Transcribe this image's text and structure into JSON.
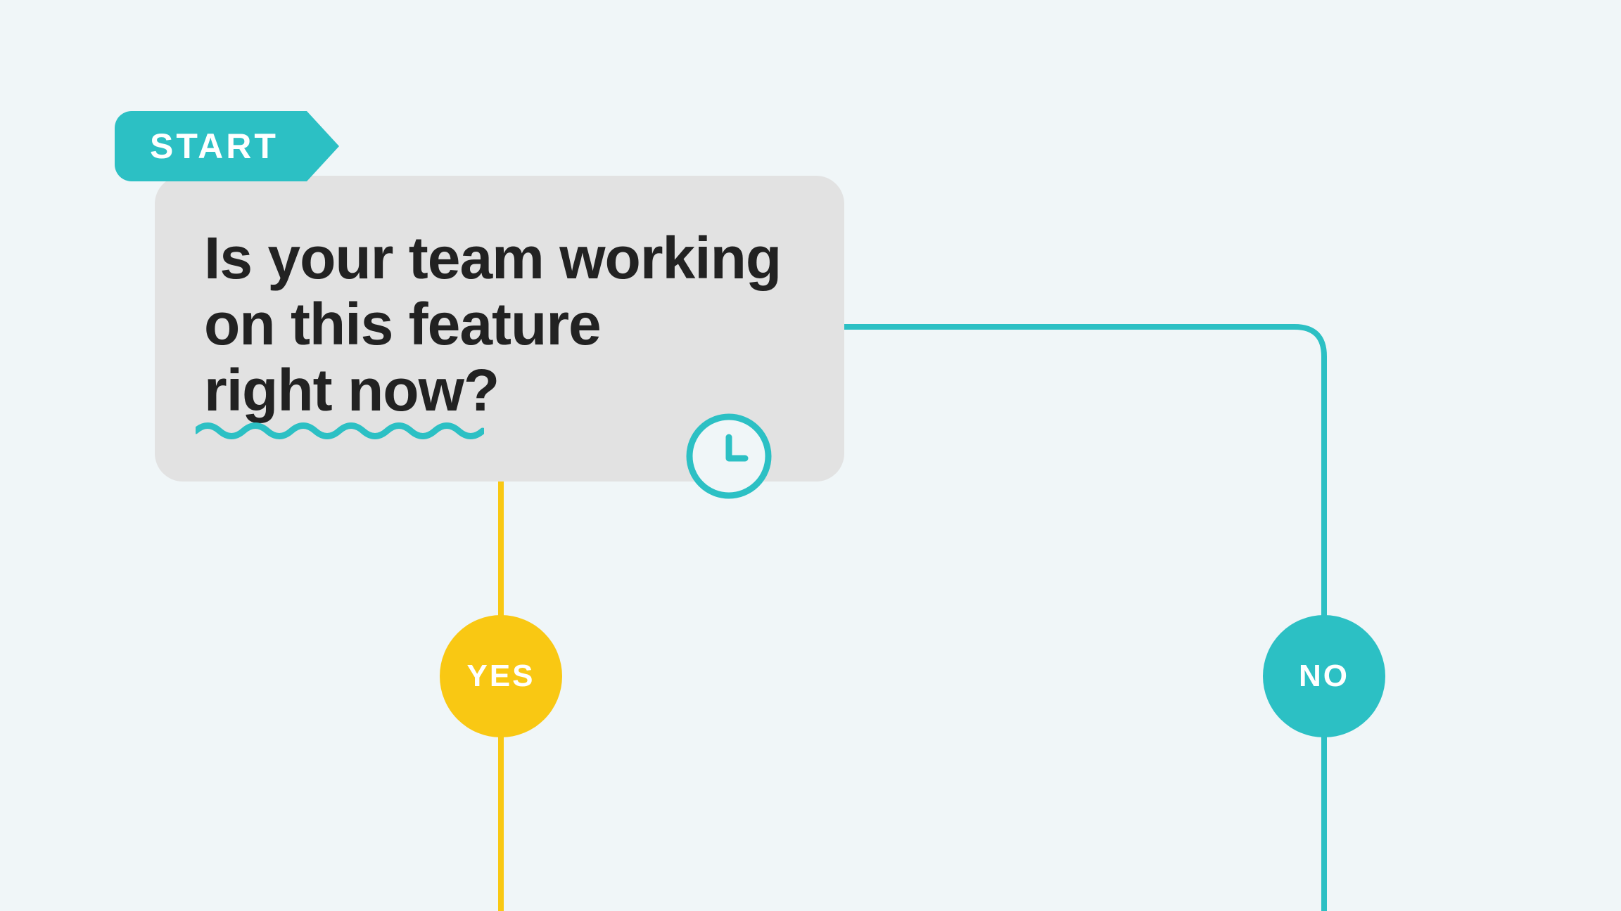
{
  "colors": {
    "teal": "#2cc0c4",
    "yellow": "#f9c813",
    "bg": "#f0f6f8",
    "card": "#e2e2e2",
    "text_dark": "#222222"
  },
  "start": {
    "label": "START"
  },
  "question": {
    "line1": "Is your team working",
    "line2": "on this feature",
    "line3": "right now?"
  },
  "nodes": {
    "yes": {
      "label": "YES"
    },
    "no": {
      "label": "NO"
    }
  },
  "icons": {
    "clock": "clock-icon"
  }
}
